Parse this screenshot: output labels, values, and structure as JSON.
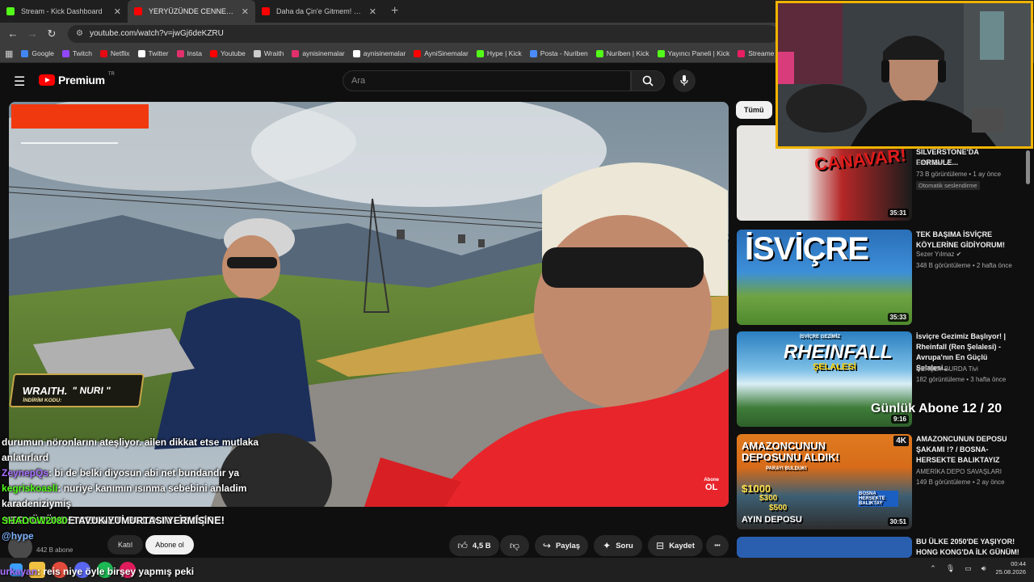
{
  "browser": {
    "tabs": [
      {
        "label": "Stream - Kick Dashboard",
        "favcolor": "#53fc18",
        "active": false
      },
      {
        "label": "YERYÜZÜNDE CENNETİ BULDU",
        "favcolor": "#ff0000",
        "active": true
      },
      {
        "label": "Daha da Çin'e Gitmem! (Haftalı",
        "favcolor": "#ff0000",
        "active": false
      }
    ],
    "new_tab": "+",
    "url": "youtube.com/watch?v=jwGj6deKZRU",
    "bookmarks": [
      {
        "label": "Google",
        "color": "#4285f4"
      },
      {
        "label": "Twitch",
        "color": "#9146ff"
      },
      {
        "label": "Netflix",
        "color": "#e50914"
      },
      {
        "label": "Twitter",
        "color": "#ffffff"
      },
      {
        "label": "Insta",
        "color": "#e1306c"
      },
      {
        "label": "Youtube",
        "color": "#ff0000"
      },
      {
        "label": "Wraith",
        "color": "#cccccc"
      },
      {
        "label": "aynisinemalar",
        "color": "#e1306c"
      },
      {
        "label": "aynisinemalar",
        "color": "#ffffff"
      },
      {
        "label": "AyniSinemalar",
        "color": "#ff0000"
      },
      {
        "label": "Hype | Kick",
        "color": "#53fc18"
      },
      {
        "label": "Posta - Nuriben",
        "color": "#4a8cff"
      },
      {
        "label": "Nuriben | Kick",
        "color": "#53fc18"
      },
      {
        "label": "Yayıncı Paneli | Kick",
        "color": "#53fc18"
      },
      {
        "label": "Streame",
        "color": "#e91e63"
      }
    ]
  },
  "youtube": {
    "logo_text": "Premium",
    "logo_tr": "TR",
    "search_placeholder": "Ara"
  },
  "video": {
    "title": "YERYÜZÜNDE CENNETİ BULDUM- İSVİÇRE!",
    "subscribers": "442 B abone",
    "kati_label": "Katıl",
    "subscribe_label": "Abone ol",
    "likes": "4,5 B",
    "share_label": "Paylaş",
    "ask_label": "Soru",
    "save_label": "Kaydet",
    "more_label": "•••",
    "watermark_top": "Abone",
    "watermark_bottom": "OL"
  },
  "overlay": {
    "wraith_name": "WRAITH.",
    "wraith_code_label": "İNDİRİM KODU:",
    "wraith_code": "\" NURI \"",
    "sub_goal": "Günlük Abone 12 / 20"
  },
  "chat": [
    {
      "user": "",
      "text": "durumun nöronlarını ateşliyor. ailen dikkat etse mutlaka anlatırlard"
    },
    {
      "user": "ZeynepQs",
      "text": ": bi de belki diyosun abi net bundandır ya"
    },
    {
      "user": "kegriskoasli",
      "text": ": nuriye kanımın ısınma sebebini anladim karadeniziymiş"
    },
    {
      "user": "SHADOW2080",
      "text": ": TAVUK YUMURTASI YERMİSİN"
    },
    {
      "user": "@hype",
      "text": ""
    },
    {
      "user": "urkayan",
      "text": ": reis niye öyle birşey yapmış peki"
    }
  ],
  "sidebar": {
    "chip_all": "Tümü",
    "items": [
      {
        "title": "SILVERSTONE'DA FORMULE...",
        "channel": "Emin San",
        "meta": "73 B görüntüleme • 1 ay önce",
        "badge": "Otomatik seslendirme",
        "duration": "35:31",
        "thumb_text": "CANAVAR!"
      },
      {
        "title": "TEK BAŞIMA İSVİÇRE KÖYLERİNE GİDİYORUM!",
        "channel": "Sezer Yılmaz",
        "meta": "348 B görüntüleme • 2 hafta önce",
        "badge": "",
        "duration": "35:33",
        "thumb_text": "İSVİÇRE"
      },
      {
        "title": "İsviçre Gezimiz Başlıyor! | Rheinfall (Ren Şelalesi) - Avrupa'nın En Güçlü Şelalesi...",
        "channel": "HERŞEY BURDA Tivi",
        "meta": "182 görüntüleme • 3 hafta önce",
        "badge": "",
        "duration": "9:16",
        "thumb_text": "RHEINFALL"
      },
      {
        "title": "AMAZONCUNUN DEPOSU ŞAKAMI !? / BOSNA-HERSEKTE BALIKTAYIZ",
        "channel": "AMERİKA DEPO SAVAŞLARI",
        "meta": "149 B görüntüleme • 2 ay önce",
        "badge": "",
        "duration": "30:51",
        "thumb_text": "AMAZONCUNUN DEPOSUNU ALDIK!"
      },
      {
        "title": "BU ÜLKE 2050'DE YAŞIYOR! HONG KONG'DA İLK GÜNÜM!",
        "channel": "",
        "meta": "",
        "badge": "",
        "duration": "",
        "thumb_text": ""
      }
    ],
    "badge_4k": "4K",
    "thumb_sub_labels": {
      "isvicre_gezimiz": "İSVİÇRE GEZİMİZ",
      "selalesi": "ŞELALESİ",
      "price_1": "$1000",
      "price_2": "$300",
      "price_3": "$500",
      "ayin_deposu": "AYIN DEPOSU",
      "bosna": "BOSNA HERSEKTE BALIKTAY",
      "parayi": "PARAYI BULDUK!"
    }
  },
  "taskbar": {
    "time": "00:44",
    "date": "25.08.2026"
  }
}
